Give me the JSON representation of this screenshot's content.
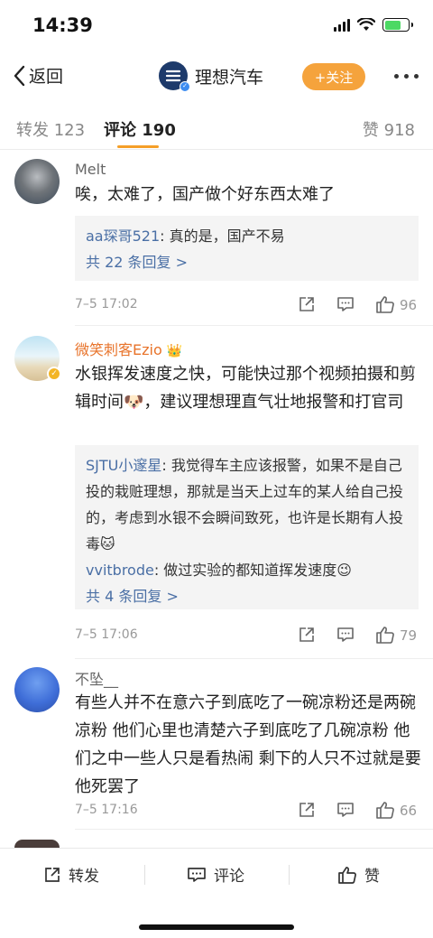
{
  "status_bar": {
    "time": "14:39"
  },
  "nav": {
    "back_label": "返回",
    "account_name": "理想汽车",
    "follow_label": "+关注"
  },
  "tabs": {
    "repost": "转发 123",
    "comment": "评论 190",
    "like": "赞 918"
  },
  "comments": [
    {
      "username": "Melt",
      "text": "唉，太难了，国产做个好东西太难了",
      "replies": [
        {
          "user": "aa琛哥521",
          "text": ": 真的是，国产不易"
        }
      ],
      "more_replies": "共 22 条回复 >",
      "time": "7–5 17:02",
      "likes": "96"
    },
    {
      "username": "微笑刺客Ezio",
      "text": "水银挥发速度之快，可能快过那个视频拍摄和剪辑时间🐶，建议理想理直气壮地报警和打官司",
      "replies": [
        {
          "user": "SJTU小邃星",
          "text": ": 我觉得车主应该报警，如果不是自己投的栽赃理想，那就是当天上过车的某人给自己投的，考虑到水银不会瞬间致死，也许是长期有人投毒🐱"
        },
        {
          "user": "vvitbrode",
          "text": ": 做过实验的都知道挥发速度😉"
        }
      ],
      "more_replies": "共 4 条回复 >",
      "time": "7–5 17:06",
      "likes": "79"
    },
    {
      "username": "不坠__",
      "text": "有些人并不在意六子到底吃了一碗凉粉还是两碗凉粉 他们心里也清楚六子到底吃了几碗凉粉 他们之中一些人只是看热闹 剩下的人只不过就是要他死罢了",
      "time": "7–5 17:16",
      "likes": "66"
    }
  ],
  "toolbar": {
    "repost": "转发",
    "comment": "评论",
    "like": "赞"
  }
}
